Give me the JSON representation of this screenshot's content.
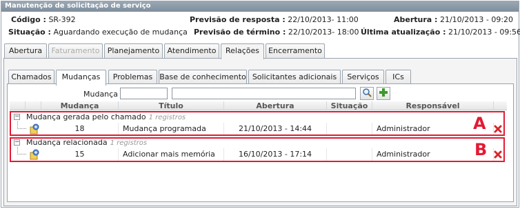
{
  "window": {
    "title": "Manutenção de solicitação de serviço"
  },
  "info": {
    "codigo_label": "Código :",
    "codigo_value": "SR-392",
    "situacao_label": "Situação :",
    "situacao_value": "Aguardando execução de mudança",
    "previsao_resposta_label": "Previsão de resposta :",
    "previsao_resposta_value": "22/10/2013- 11:00",
    "previsao_termino_label": "Previsão de término :",
    "previsao_termino_value": "22/10/2013- 18:00",
    "abertura_label": "Abertura :",
    "abertura_value": "21/10/2013 - 09:20",
    "ultima_label": "Última atualização :",
    "ultima_value": "21/10/2013 - 09:56"
  },
  "outer_tabs": [
    {
      "label": "Abertura"
    },
    {
      "label": "Faturamento"
    },
    {
      "label": "Planejamento"
    },
    {
      "label": "Atendimento"
    },
    {
      "label": "Relações"
    },
    {
      "label": "Encerramento"
    }
  ],
  "inner_tabs": [
    {
      "label": "Chamados"
    },
    {
      "label": "Mudanças"
    },
    {
      "label": "Problemas"
    },
    {
      "label": "Base de conhecimento"
    },
    {
      "label": "Solicitantes adicionais"
    },
    {
      "label": "Serviços"
    },
    {
      "label": "ICs"
    }
  ],
  "search": {
    "label": "Mudança :",
    "code_value": "",
    "name_value": ""
  },
  "grid": {
    "columns": [
      "Mudança",
      "Título",
      "Abertura",
      "Situação",
      "Responsável"
    ],
    "groups": [
      {
        "name": "Mudança gerada pelo chamado",
        "count": "1 registros",
        "marker": "A",
        "rows": [
          {
            "mudanca": "18",
            "titulo": "Mudança programada",
            "abertura": "21/10/2013 - 14:44",
            "situacao": "",
            "responsavel": "Administrador"
          }
        ]
      },
      {
        "name": "Mudança relacionada",
        "count": "1 registros",
        "marker": "B",
        "rows": [
          {
            "mudanca": "15",
            "titulo": "Adicionar mais memória",
            "abertura": "16/10/2013 - 17:14",
            "situacao": "",
            "responsavel": "Administrador"
          }
        ]
      }
    ]
  },
  "colors": {
    "highlight": "#e21a33",
    "titlebar": "#8a98a6"
  }
}
